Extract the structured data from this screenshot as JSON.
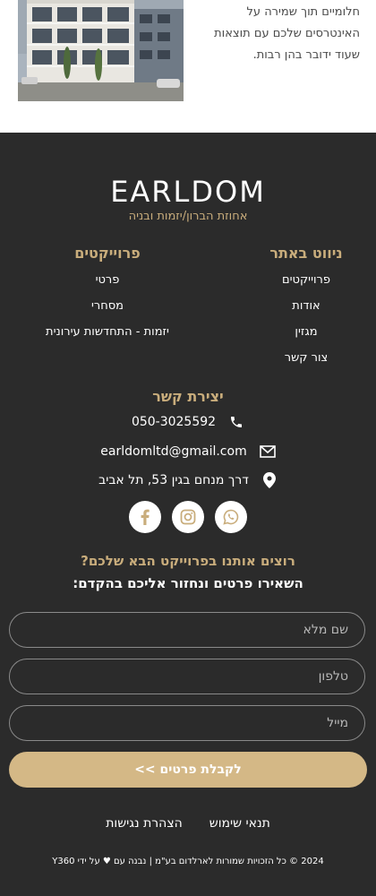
{
  "top": {
    "text_lines": [
      "חלומיים תוך שמירה על",
      "האינטרסים שלכם עם תוצאות",
      "שעוד ידובר בהן רבות."
    ]
  },
  "logo": {
    "word": "EARLDOM",
    "subtitle": "אחוזת הברון/יזמות ובניה"
  },
  "nav": {
    "title": "ניווט באתר",
    "items": [
      "פרוייקטים",
      "אודות",
      "מגזין",
      "צור קשר"
    ]
  },
  "projects": {
    "title": "פרוייקטים",
    "items": [
      "פרטי",
      "מסחרי",
      "יזמות - התחדשות עירונית"
    ]
  },
  "contact": {
    "title": "יצירת קשר",
    "phone": "050-3025592",
    "email": "earldomltd@gmail.com",
    "address": "דרך מנחם בגין 53, תל אביב"
  },
  "socials": [
    "whatsapp-icon",
    "instagram-icon",
    "facebook-icon"
  ],
  "cta": {
    "line1": "רוצים אותנו בפרוייקט הבא שלכם?",
    "line2": "השאירו פרטים ונחזור אליכם בהקדם:"
  },
  "form": {
    "name_placeholder": "שם מלא",
    "phone_placeholder": "טלפון",
    "email_placeholder": "מייל",
    "submit_label": "לקבלת פרטים >>"
  },
  "legal": {
    "terms": "תנאי שימוש",
    "accessibility": "הצהרת נגישות"
  },
  "copyright": "2024 © כל הזכויות שמורות לארלדום בע\"מ | נבנה עם ♥ על ידי Y360",
  "colors": {
    "footer_bg": "#2b2b2b",
    "gold": "#c9ad7c",
    "button": "#d4b886"
  }
}
